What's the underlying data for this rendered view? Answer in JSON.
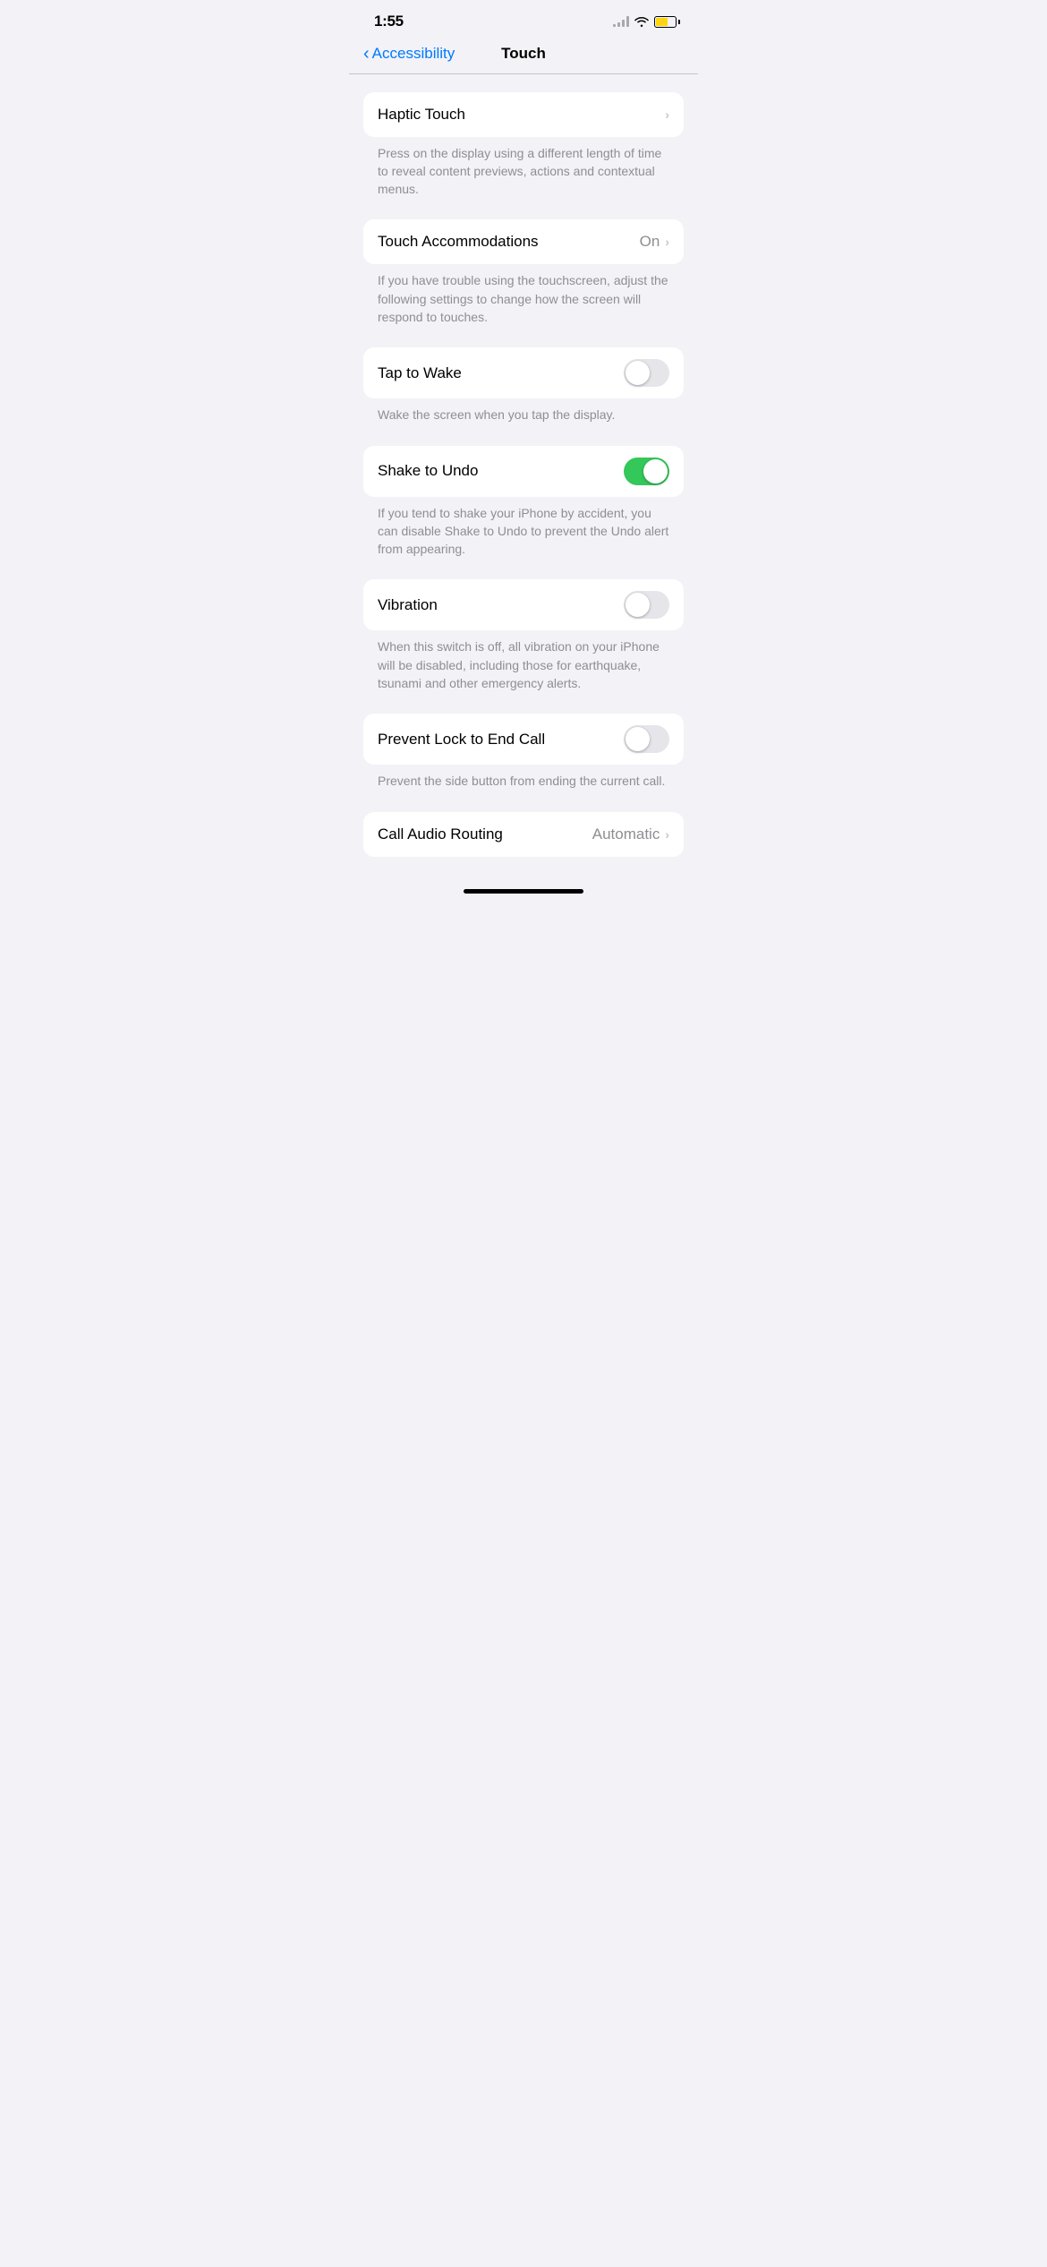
{
  "statusBar": {
    "time": "1:55",
    "battery": "60%"
  },
  "nav": {
    "backLabel": "Accessibility",
    "title": "Touch"
  },
  "settings": [
    {
      "id": "haptic-touch",
      "label": "Haptic Touch",
      "type": "disclosure",
      "value": null,
      "description": "Press on the display using a different length of time to reveal content previews, actions and contextual menus."
    },
    {
      "id": "touch-accommodations",
      "label": "Touch Accommodations",
      "type": "disclosure",
      "value": "On",
      "description": "If you have trouble using the touchscreen, adjust the following settings to change how the screen will respond to touches."
    },
    {
      "id": "tap-to-wake",
      "label": "Tap to Wake",
      "type": "toggle",
      "value": false,
      "description": "Wake the screen when you tap the display."
    },
    {
      "id": "shake-to-undo",
      "label": "Shake to Undo",
      "type": "toggle",
      "value": true,
      "description": "If you tend to shake your iPhone by accident, you can disable Shake to Undo to prevent the Undo alert from appearing."
    },
    {
      "id": "vibration",
      "label": "Vibration",
      "type": "toggle",
      "value": false,
      "description": "When this switch is off, all vibration on your iPhone will be disabled, including those for earthquake, tsunami and other emergency alerts."
    },
    {
      "id": "prevent-lock-to-end-call",
      "label": "Prevent Lock to End Call",
      "type": "toggle",
      "value": false,
      "description": "Prevent the side button from ending the current call."
    },
    {
      "id": "call-audio-routing",
      "label": "Call Audio Routing",
      "type": "disclosure",
      "value": "Automatic",
      "description": null
    }
  ],
  "labels": {
    "on": "On",
    "automatic": "Automatic"
  }
}
